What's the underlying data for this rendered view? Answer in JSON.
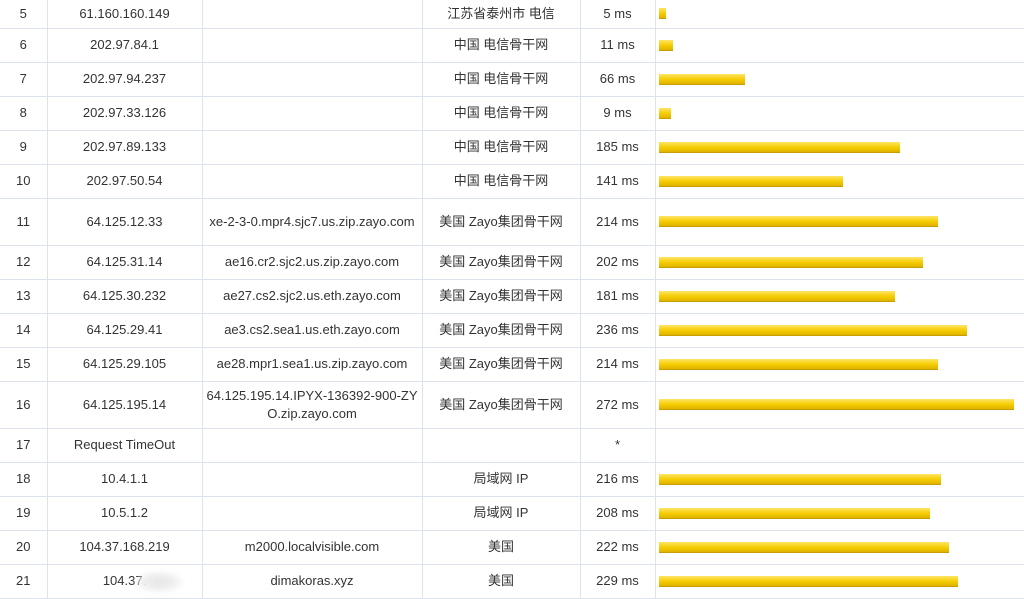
{
  "colors": {
    "bar_fill": "#f5cc00",
    "grid_line": "#dde3ea",
    "text": "#333333"
  },
  "max_time_ms": 272,
  "rows": [
    {
      "hop": "5",
      "ip": "61.160.160.149",
      "host": "",
      "location": "江苏省泰州市 电信",
      "time": "5 ms",
      "ms": 5
    },
    {
      "hop": "6",
      "ip": "202.97.84.1",
      "host": "",
      "location": "中国 电信骨干网",
      "time": "11 ms",
      "ms": 11
    },
    {
      "hop": "7",
      "ip": "202.97.94.237",
      "host": "",
      "location": "中国 电信骨干网",
      "time": "66 ms",
      "ms": 66
    },
    {
      "hop": "8",
      "ip": "202.97.33.126",
      "host": "",
      "location": "中国 电信骨干网",
      "time": "9 ms",
      "ms": 9
    },
    {
      "hop": "9",
      "ip": "202.97.89.133",
      "host": "",
      "location": "中国 电信骨干网",
      "time": "185 ms",
      "ms": 185
    },
    {
      "hop": "10",
      "ip": "202.97.50.54",
      "host": "",
      "location": "中国 电信骨干网",
      "time": "141 ms",
      "ms": 141
    },
    {
      "hop": "11",
      "ip": "64.125.12.33",
      "host": "xe-2-3-0.mpr4.sjc7.us.zip.zayo.com",
      "location": "美国 Zayo集团骨干网",
      "time": "214 ms",
      "ms": 214
    },
    {
      "hop": "12",
      "ip": "64.125.31.14",
      "host": "ae16.cr2.sjc2.us.zip.zayo.com",
      "location": "美国 Zayo集团骨干网",
      "time": "202 ms",
      "ms": 202
    },
    {
      "hop": "13",
      "ip": "64.125.30.232",
      "host": "ae27.cs2.sjc2.us.eth.zayo.com",
      "location": "美国 Zayo集团骨干网",
      "time": "181 ms",
      "ms": 181
    },
    {
      "hop": "14",
      "ip": "64.125.29.41",
      "host": "ae3.cs2.sea1.us.eth.zayo.com",
      "location": "美国 Zayo集团骨干网",
      "time": "236 ms",
      "ms": 236
    },
    {
      "hop": "15",
      "ip": "64.125.29.105",
      "host": "ae28.mpr1.sea1.us.zip.zayo.com",
      "location": "美国 Zayo集团骨干网",
      "time": "214 ms",
      "ms": 214
    },
    {
      "hop": "16",
      "ip": "64.125.195.14",
      "host": "64.125.195.14.IPYX-136392-900-ZYO.zip.zayo.com",
      "location": "美国 Zayo集团骨干网",
      "time": "272 ms",
      "ms": 272
    },
    {
      "hop": "17",
      "ip": "Request TimeOut",
      "host": "",
      "location": "",
      "time": "*",
      "ms": 0
    },
    {
      "hop": "18",
      "ip": "10.4.1.1",
      "host": "",
      "location": "局域网 IP",
      "time": "216 ms",
      "ms": 216
    },
    {
      "hop": "19",
      "ip": "10.5.1.2",
      "host": "",
      "location": "局域网 IP",
      "time": "208 ms",
      "ms": 208
    },
    {
      "hop": "20",
      "ip": "104.37.168.219",
      "host": "m2000.localvisible.com",
      "location": "美国",
      "time": "222 ms",
      "ms": 222
    },
    {
      "hop": "21",
      "ip": "104.37.",
      "host": "dimakoras.xyz",
      "location": "美国",
      "time": "229 ms",
      "ms": 229
    }
  ]
}
